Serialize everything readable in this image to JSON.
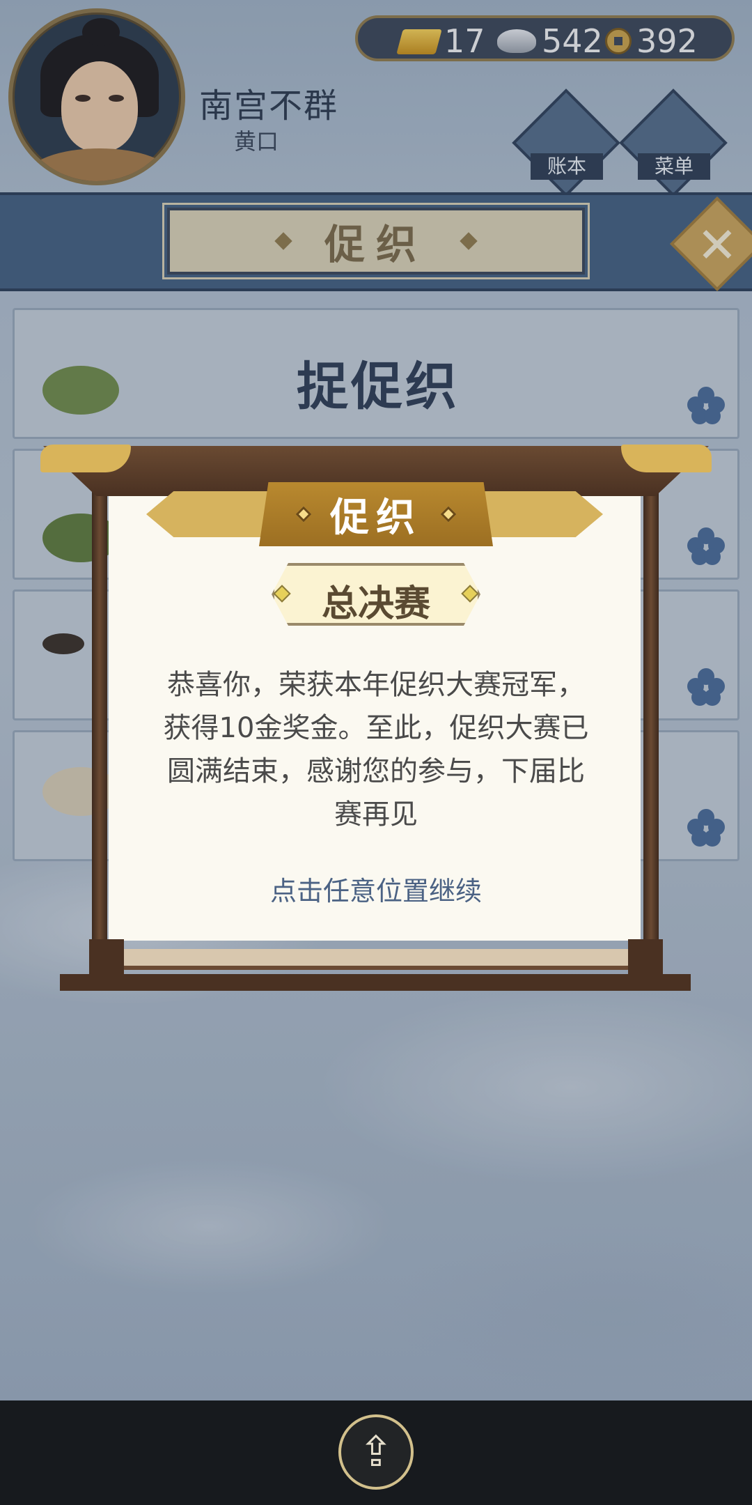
{
  "player": {
    "name": "南宫不群",
    "rank": "黄口"
  },
  "currency": {
    "gold": "17",
    "silver": "542",
    "coins": "392"
  },
  "menu_buttons": {
    "ledger_label": "账本",
    "menu_label": "菜单"
  },
  "header": {
    "title": "促织",
    "close_symbol": "✕"
  },
  "list": {
    "first_card_title": "捉促织"
  },
  "dialog": {
    "title": "促织",
    "badge": "总决赛",
    "message_lines": [
      "恭喜你，荣获本年促织大赛冠军，",
      "获得10金奖金。至此，促织大赛已",
      "圆满结束，感谢您的参与，下届比",
      "赛再见"
    ],
    "hint": "点击任意位置继续"
  },
  "bottom": {
    "share_icon": "share-icon"
  },
  "colors": {
    "accent_gold": "#b9892f",
    "panel": "#fbf9f1",
    "header_blue": "#44607f"
  }
}
